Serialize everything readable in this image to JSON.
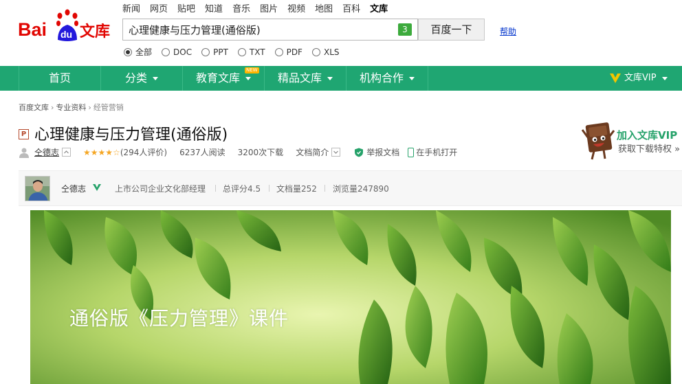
{
  "top_nav": [
    "新闻",
    "网页",
    "贴吧",
    "知道",
    "音乐",
    "图片",
    "视频",
    "地图",
    "百科",
    "文库"
  ],
  "top_nav_active": "文库",
  "logo": {
    "bai": "Bai",
    "du": "du",
    "wenku": "文库"
  },
  "search": {
    "value": "心理健康与压力管理(通俗版)",
    "badge": "3",
    "button_label": "百度一下"
  },
  "help_link": "帮助",
  "filters": [
    {
      "label": "全部",
      "checked": true
    },
    {
      "label": "DOC",
      "checked": false
    },
    {
      "label": "PPT",
      "checked": false
    },
    {
      "label": "TXT",
      "checked": false
    },
    {
      "label": "PDF",
      "checked": false
    },
    {
      "label": "XLS",
      "checked": false
    }
  ],
  "navbar": {
    "items": [
      "首页",
      "分类",
      "教育文库",
      "精品文库",
      "机构合作"
    ],
    "new_badge": "NEW",
    "vip": "文库VIP",
    "color": "#1fa672"
  },
  "breadcrumb": [
    "百度文库",
    "专业资料",
    "经管营销"
  ],
  "doc": {
    "type_tag": "P",
    "title": "心理健康与压力管理(通俗版)",
    "author": "仝德志",
    "rating_count": "(294人评价)",
    "reads": "6237人阅读",
    "downloads": "3200次下载",
    "summary": "文档简介",
    "report": "举报文档",
    "mobile": "在手机打开"
  },
  "vip_promo": {
    "title": "加入文库VIP",
    "subtitle": "获取下载特权"
  },
  "author_bar": {
    "name": "仝德志",
    "role": "上市公司企业文化部经理",
    "score": "总评分4.5",
    "doc_count": "文档量252",
    "views": "浏览量247890"
  },
  "banner": {
    "text": "通俗版《压力管理》课件"
  }
}
